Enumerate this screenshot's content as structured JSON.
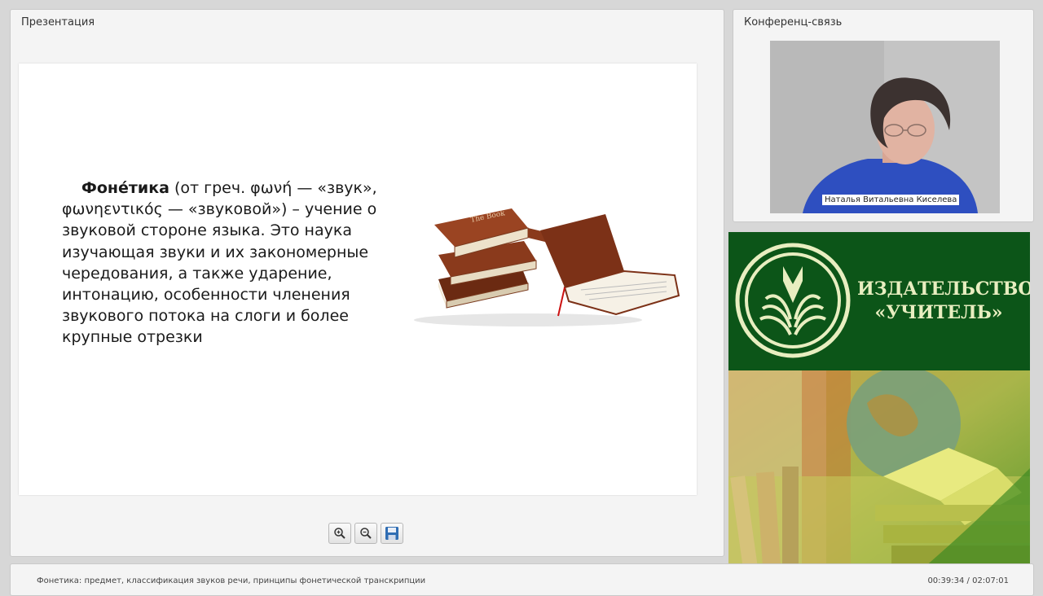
{
  "presentation": {
    "title": "Презентация",
    "slide": {
      "term": "Фоне́тика",
      "body": " (от греч. φωνή — «звук», φωνηεντικός — «звуковой»)  – учение о звуковой стороне языка. Это наука изучающая звуки и их закономерные чередования, а также ударение, интонацию, особенности членения звукового потока на слоги и более крупные отрезки",
      "book_label": "The Book"
    },
    "controls": {
      "zoom_in_icon": "zoom-in-icon",
      "zoom_out_icon": "zoom-out-icon",
      "save_icon": "save-icon"
    }
  },
  "conference": {
    "title": "Конференц-связь",
    "speaker_name": "Наталья Витальевна Киселева"
  },
  "publisher": {
    "name_line1": "ИЗДАТЕЛЬСТВО",
    "name_line2": "«УЧИТЕЛЬ»",
    "brand_color": "#0c5518",
    "accent_color": "#e8eec0"
  },
  "footer": {
    "lesson_title": "Фонетика: предмет, классификация звуков речи, принципы фонетической транскрипции",
    "timecode": "00:39:34 / 02:07:01"
  }
}
